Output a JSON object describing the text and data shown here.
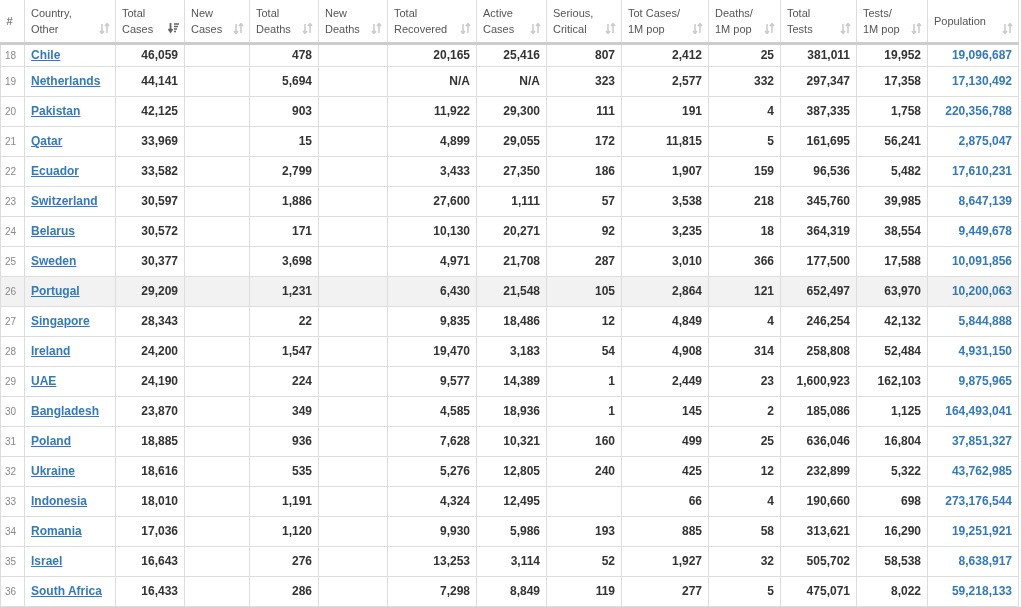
{
  "table": {
    "columns": [
      {
        "label": "#"
      },
      {
        "label": "Country,\nOther",
        "sorted": false
      },
      {
        "label": "Total\nCases",
        "sorted": true
      },
      {
        "label": "New\nCases",
        "sorted": false
      },
      {
        "label": "Total\nDeaths",
        "sorted": false
      },
      {
        "label": "New\nDeaths",
        "sorted": false
      },
      {
        "label": "Total\nRecovered",
        "sorted": false
      },
      {
        "label": "Active\nCases",
        "sorted": false
      },
      {
        "label": "Serious,\nCritical",
        "sorted": false
      },
      {
        "label": "Tot Cases/\n1M pop",
        "sorted": false
      },
      {
        "label": "Deaths/\n1M pop",
        "sorted": false
      },
      {
        "label": "Total\nTests",
        "sorted": false
      },
      {
        "label": "Tests/\n1M pop",
        "sorted": false
      },
      {
        "label": "Population",
        "sorted": false
      }
    ],
    "rows": [
      {
        "selected": false,
        "cells": [
          "18",
          "Chile",
          "46,059",
          "",
          "478",
          "",
          "20,165",
          "25,416",
          "807",
          "2,412",
          "25",
          "381,011",
          "19,952",
          "19,096,687"
        ]
      },
      {
        "selected": false,
        "cells": [
          "19",
          "Netherlands",
          "44,141",
          "",
          "5,694",
          "",
          "N/A",
          "N/A",
          "323",
          "2,577",
          "332",
          "297,347",
          "17,358",
          "17,130,492"
        ]
      },
      {
        "selected": false,
        "cells": [
          "20",
          "Pakistan",
          "42,125",
          "",
          "903",
          "",
          "11,922",
          "29,300",
          "111",
          "191",
          "4",
          "387,335",
          "1,758",
          "220,356,788"
        ]
      },
      {
        "selected": false,
        "cells": [
          "21",
          "Qatar",
          "33,969",
          "",
          "15",
          "",
          "4,899",
          "29,055",
          "172",
          "11,815",
          "5",
          "161,695",
          "56,241",
          "2,875,047"
        ]
      },
      {
        "selected": false,
        "cells": [
          "22",
          "Ecuador",
          "33,582",
          "",
          "2,799",
          "",
          "3,433",
          "27,350",
          "186",
          "1,907",
          "159",
          "96,536",
          "5,482",
          "17,610,231"
        ]
      },
      {
        "selected": false,
        "cells": [
          "23",
          "Switzerland",
          "30,597",
          "",
          "1,886",
          "",
          "27,600",
          "1,111",
          "57",
          "3,538",
          "218",
          "345,760",
          "39,985",
          "8,647,139"
        ]
      },
      {
        "selected": false,
        "cells": [
          "24",
          "Belarus",
          "30,572",
          "",
          "171",
          "",
          "10,130",
          "20,271",
          "92",
          "3,235",
          "18",
          "364,319",
          "38,554",
          "9,449,678"
        ]
      },
      {
        "selected": false,
        "cells": [
          "25",
          "Sweden",
          "30,377",
          "",
          "3,698",
          "",
          "4,971",
          "21,708",
          "287",
          "3,010",
          "366",
          "177,500",
          "17,588",
          "10,091,856"
        ]
      },
      {
        "selected": true,
        "cells": [
          "26",
          "Portugal",
          "29,209",
          "",
          "1,231",
          "",
          "6,430",
          "21,548",
          "105",
          "2,864",
          "121",
          "652,497",
          "63,970",
          "10,200,063"
        ]
      },
      {
        "selected": false,
        "cells": [
          "27",
          "Singapore",
          "28,343",
          "",
          "22",
          "",
          "9,835",
          "18,486",
          "12",
          "4,849",
          "4",
          "246,254",
          "42,132",
          "5,844,888"
        ]
      },
      {
        "selected": false,
        "cells": [
          "28",
          "Ireland",
          "24,200",
          "",
          "1,547",
          "",
          "19,470",
          "3,183",
          "54",
          "4,908",
          "314",
          "258,808",
          "52,484",
          "4,931,150"
        ]
      },
      {
        "selected": false,
        "cells": [
          "29",
          "UAE",
          "24,190",
          "",
          "224",
          "",
          "9,577",
          "14,389",
          "1",
          "2,449",
          "23",
          "1,600,923",
          "162,103",
          "9,875,965"
        ]
      },
      {
        "selected": false,
        "cells": [
          "30",
          "Bangladesh",
          "23,870",
          "",
          "349",
          "",
          "4,585",
          "18,936",
          "1",
          "145",
          "2",
          "185,086",
          "1,125",
          "164,493,041"
        ]
      },
      {
        "selected": false,
        "cells": [
          "31",
          "Poland",
          "18,885",
          "",
          "936",
          "",
          "7,628",
          "10,321",
          "160",
          "499",
          "25",
          "636,046",
          "16,804",
          "37,851,327"
        ]
      },
      {
        "selected": false,
        "cells": [
          "32",
          "Ukraine",
          "18,616",
          "",
          "535",
          "",
          "5,276",
          "12,805",
          "240",
          "425",
          "12",
          "232,899",
          "5,322",
          "43,762,985"
        ]
      },
      {
        "selected": false,
        "cells": [
          "33",
          "Indonesia",
          "18,010",
          "",
          "1,191",
          "",
          "4,324",
          "12,495",
          "",
          "66",
          "4",
          "190,660",
          "698",
          "273,176,544"
        ]
      },
      {
        "selected": false,
        "cells": [
          "34",
          "Romania",
          "17,036",
          "",
          "1,120",
          "",
          "9,930",
          "5,986",
          "193",
          "885",
          "58",
          "313,621",
          "16,290",
          "19,251,921"
        ]
      },
      {
        "selected": false,
        "cells": [
          "35",
          "Israel",
          "16,643",
          "",
          "276",
          "",
          "13,253",
          "3,114",
          "52",
          "1,927",
          "32",
          "505,702",
          "58,538",
          "8,638,917"
        ]
      },
      {
        "selected": false,
        "cells": [
          "36",
          "South Africa",
          "16,433",
          "",
          "286",
          "",
          "7,298",
          "8,849",
          "119",
          "277",
          "5",
          "475,071",
          "8,022",
          "59,218,133"
        ]
      }
    ]
  }
}
